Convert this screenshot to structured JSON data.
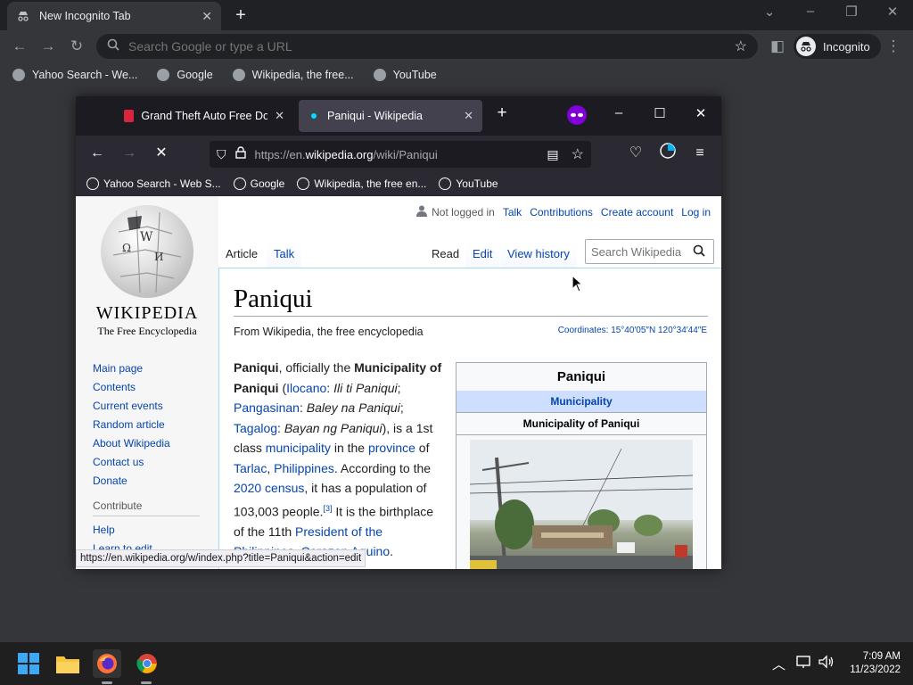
{
  "chrome": {
    "tab_title": "New Incognito Tab",
    "omnibox_placeholder": "Search Google or type a URL",
    "incognito_label": "Incognito",
    "bookmarks": [
      "Yahoo Search - We...",
      "Google",
      "Wikipedia, the free...",
      "YouTube"
    ]
  },
  "firefox": {
    "tabs": [
      {
        "title": "Grand Theft Auto Free Down",
        "active": false
      },
      {
        "title": "Paniqui - Wikipedia",
        "active": true
      }
    ],
    "url_prefix": "https://en.",
    "url_domain": "wikipedia.org",
    "url_path": "/wiki/Paniqui",
    "bookmarks": [
      "Yahoo Search - Web S...",
      "Google",
      "Wikipedia, the free en...",
      "YouTube"
    ],
    "status_url": "https://en.wikipedia.org/w/index.php?title=Paniqui&action=edit"
  },
  "wiki": {
    "wordmark": "WIKIPEDIA",
    "tagline": "The Free Encyclopedia",
    "nav": [
      "Main page",
      "Contents",
      "Current events",
      "Random article",
      "About Wikipedia",
      "Contact us",
      "Donate"
    ],
    "contribute_heading": "Contribute",
    "contribute": [
      "Help",
      "Learn to edit"
    ],
    "userbar": {
      "not_logged_in": "Not logged in",
      "talk": "Talk",
      "contributions": "Contributions",
      "create_account": "Create account",
      "login": "Log in"
    },
    "tabs": {
      "article": "Article",
      "talk": "Talk",
      "read": "Read",
      "edit": "Edit",
      "history": "View history"
    },
    "search_placeholder": "Search Wikipedia",
    "title": "Paniqui",
    "from": "From Wikipedia, the free encyclopedia",
    "coords_label": "Coordinates:",
    "coords": "15°40′05″N 120°34′44″E",
    "infobox": {
      "title": "Paniqui",
      "type": "Municipality",
      "name": "Municipality of Paniqui"
    }
  },
  "taskbar": {
    "time": "7:09 AM",
    "date": "11/23/2022"
  }
}
